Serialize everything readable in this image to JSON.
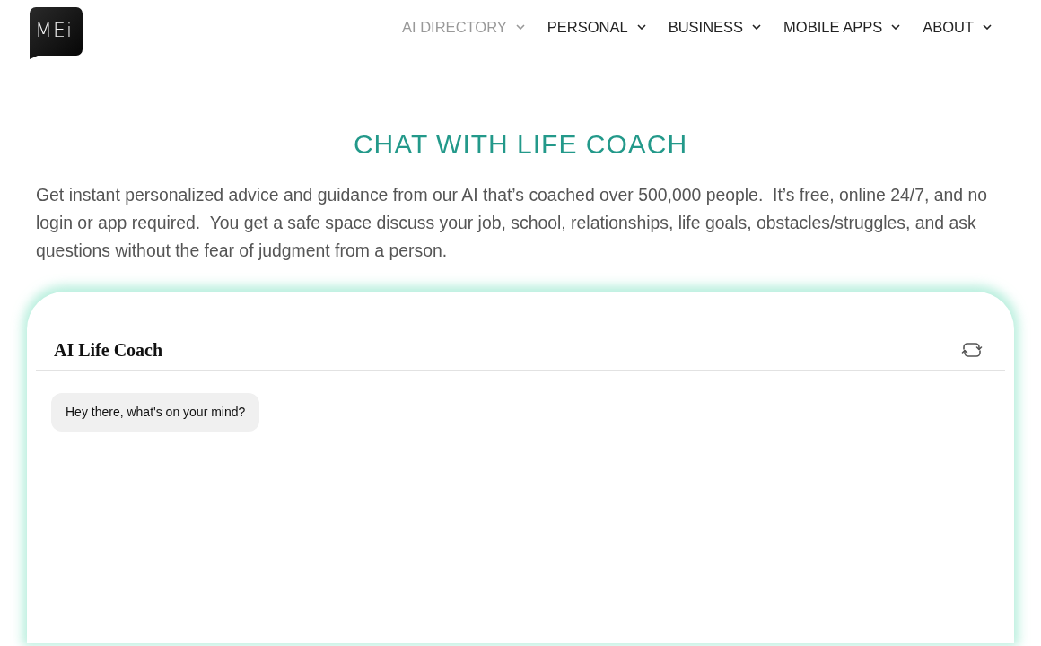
{
  "logo": {
    "text": "MEi"
  },
  "nav": [
    {
      "label": "AI DIRECTORY",
      "selected": true
    },
    {
      "label": "PERSONAL",
      "selected": false
    },
    {
      "label": "BUSINESS",
      "selected": false
    },
    {
      "label": "MOBILE APPS",
      "selected": false
    },
    {
      "label": "ABOUT",
      "selected": false
    }
  ],
  "page": {
    "title": "CHAT WITH LIFE COACH",
    "intro": "Get instant personalized advice and guidance from our AI that’s coached over 500,000 people.  It’s free, online 24/7, and no login or app required.  You get a safe space discuss your job, school, relationships, life goals, obstacles/struggles, and ask questions without the fear of judgment from a person."
  },
  "chat": {
    "title": "AI Life Coach",
    "messages": [
      {
        "kind": "bot",
        "text": "Hey there, what's on your mind?"
      }
    ]
  }
}
